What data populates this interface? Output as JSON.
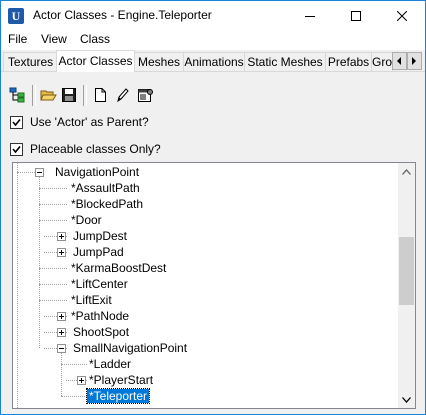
{
  "window": {
    "title": "Actor Classes - Engine.Teleporter",
    "minimize_icon": "minimize-icon",
    "maximize_icon": "maximize-icon",
    "close_icon": "close-icon",
    "app_icon": "unreal-editor-icon"
  },
  "menu": {
    "items": [
      "File",
      "View",
      "Class"
    ]
  },
  "tabs": {
    "items": [
      "Textures",
      "Actor Classes",
      "Meshes",
      "Animations",
      "Static Meshes",
      "Prefabs",
      "Gro"
    ],
    "active": "Actor Classes"
  },
  "toolbar": {
    "icons": [
      "class-tree-icon",
      "open-folder-icon",
      "save-disk-icon",
      "new-document-icon",
      "edit-pencil-icon",
      "properties-icon"
    ]
  },
  "options": {
    "use_actor_parent": {
      "label": "Use 'Actor' as Parent?",
      "checked": true
    },
    "placeable_only": {
      "label": "Placeable classes Only?",
      "checked": true
    }
  },
  "tree": {
    "nodes": [
      {
        "label": "NavigationPoint",
        "expander": "minus"
      },
      {
        "label": "*AssaultPath",
        "expander": "none"
      },
      {
        "label": "*BlockedPath",
        "expander": "none"
      },
      {
        "label": "*Door",
        "expander": "none"
      },
      {
        "label": "JumpDest",
        "expander": "plus"
      },
      {
        "label": "JumpPad",
        "expander": "plus"
      },
      {
        "label": "*KarmaBoostDest",
        "expander": "none"
      },
      {
        "label": "*LiftCenter",
        "expander": "none"
      },
      {
        "label": "*LiftExit",
        "expander": "none"
      },
      {
        "label": "*PathNode",
        "expander": "plus"
      },
      {
        "label": "ShootSpot",
        "expander": "plus"
      },
      {
        "label": "SmallNavigationPoint",
        "expander": "minus"
      },
      {
        "label": "*Ladder",
        "expander": "none"
      },
      {
        "label": "*PlayerStart",
        "expander": "plus"
      },
      {
        "label": "*Teleporter",
        "expander": "none",
        "selected": true
      }
    ]
  },
  "colors": {
    "selection": "#0078d7",
    "window_border": "#1883d7",
    "scroll_thumb": "#cdcdcd"
  }
}
